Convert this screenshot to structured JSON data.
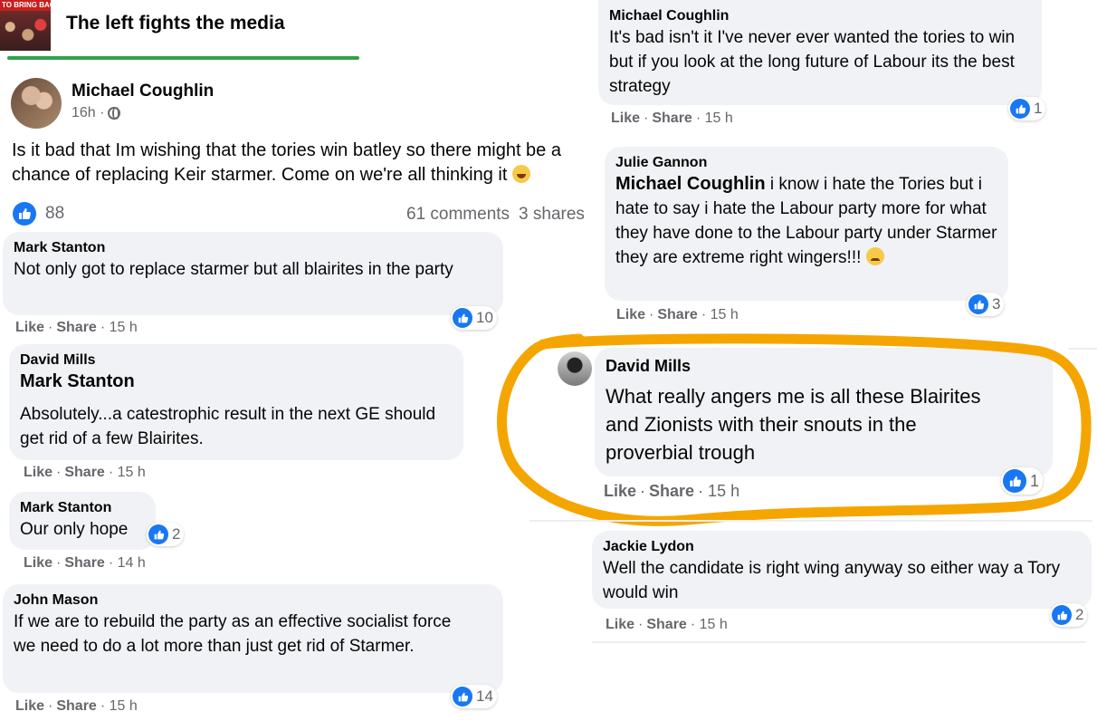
{
  "group": {
    "thumb_text": "TO BRING BACK SO",
    "title": "The left fights the media"
  },
  "post": {
    "author": "Michael Coughlin",
    "time": "16h ·",
    "text": "Is it bad that Im wishing that the tories win batley so there might be a chance of replacing  Keir starmer. Come on we're all thinking it",
    "likes": "88",
    "comments": "61 comments",
    "shares": "3 shares"
  },
  "actions": {
    "like": "Like",
    "share": "Share"
  },
  "comments": [
    {
      "name": "Mark Stanton",
      "text": "Not only got to replace starmer but all blairites in the party",
      "time": "· 15 h",
      "reactions": "10"
    },
    {
      "name": "David Mills",
      "mention": "Mark Stanton",
      "text": "Absolutely...a catestrophic result in the next GE should get rid of a few Blairites.",
      "time": "· 15 h"
    },
    {
      "name": "Mark Stanton",
      "text": "Our only hope",
      "time": "· 14 h",
      "reactions": "2"
    },
    {
      "name": "John Mason",
      "text": "If we are to rebuild the party as an effective socialist force we need to do a lot more than just get rid of Starmer.",
      "time": "· 15 h",
      "reactions": "14"
    },
    {
      "name": "Michael Coughlin",
      "text": "It's bad isn't it I've never ever wanted the tories to win but if you look at the long future of Labour its the best strategy",
      "time": "· 15 h",
      "reactions": "1"
    },
    {
      "name": "Julie Gannon",
      "mention": "Michael Coughlin",
      "text": "i know i hate the Tories but i hate to say i hate the Labour party more for what they have done to the Labour party under Starmer they are extreme right wingers!!!",
      "time": "· 15 h",
      "reactions": "3"
    },
    {
      "name": "David Mills",
      "text": "What really angers me is all these Blairites and Zionists with their snouts in the proverbial trough",
      "time": "· 15 h",
      "reactions": "1"
    },
    {
      "name": "Jackie Lydon",
      "text": "Well the candidate is right wing anyway so either way a Tory would win",
      "time": "· 15 h",
      "reactions": "2"
    }
  ],
  "colors": {
    "accent": "#1877f2",
    "highlight": "#f5a500",
    "underline": "#31a24c",
    "bubble": "#f0f2f5"
  }
}
